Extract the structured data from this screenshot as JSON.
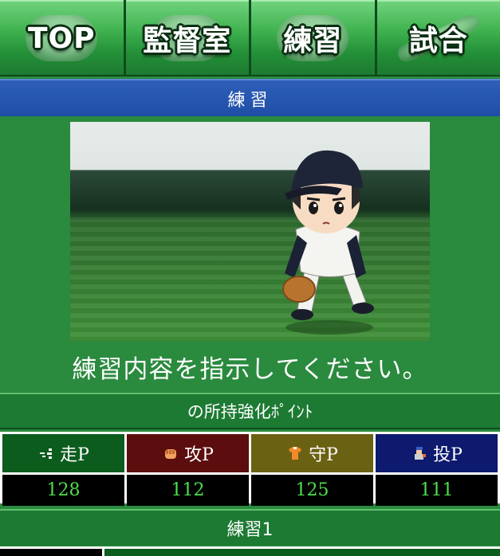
{
  "nav": {
    "items": [
      {
        "label": "TOP",
        "icon": "baseball-icon"
      },
      {
        "label": "監督室",
        "icon": "cap-icon"
      },
      {
        "label": "練習",
        "icon": "glove-icon"
      },
      {
        "label": "試合",
        "icon": "bat-icon"
      }
    ]
  },
  "title": "練習",
  "instruction": "練習内容を指示してください。",
  "points": {
    "header": "の所持強化ﾎﾟｲﾝﾄ",
    "stats": [
      {
        "label": "走P",
        "value": "128",
        "icon": "run-icon",
        "color": "#0c5c1e"
      },
      {
        "label": "攻P",
        "value": "112",
        "icon": "fist-icon",
        "color": "#5c0d0d"
      },
      {
        "label": "守P",
        "value": "125",
        "icon": "shirt-icon",
        "color": "#6b6112"
      },
      {
        "label": "投P",
        "value": "111",
        "icon": "pitcher-icon",
        "color": "#0d1a6e"
      }
    ]
  },
  "practice_label": "練習1",
  "colors": {
    "value_text": "#4ddf4d",
    "title_bar": "#1f4ea6",
    "background": "#2a8a3e"
  }
}
